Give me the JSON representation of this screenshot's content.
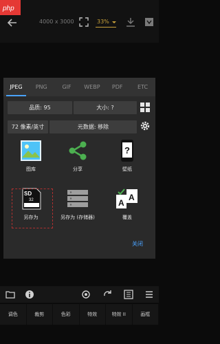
{
  "topbar": {
    "dimensions": "4000 x 3000",
    "zoom": "33%"
  },
  "tabs": [
    {
      "label": "JPEG",
      "active": true
    },
    {
      "label": "PNG",
      "active": false
    },
    {
      "label": "GIF",
      "active": false
    },
    {
      "label": "WEBP",
      "active": false
    },
    {
      "label": "PDF",
      "active": false
    },
    {
      "label": "ETC",
      "active": false
    }
  ],
  "options": {
    "quality": "品质: 95",
    "size": "大小: ?",
    "dpi": "72 像素/英寸",
    "metadata": "元数据: 移除"
  },
  "actions": [
    {
      "label": "图库",
      "icon": "gallery-icon"
    },
    {
      "label": "分享",
      "icon": "share-icon"
    },
    {
      "label": "壁纸",
      "icon": "wallpaper-icon"
    },
    {
      "label": "另存为",
      "icon": "sd-card-icon"
    },
    {
      "label": "另存为 (存储器)",
      "icon": "storage-icon"
    },
    {
      "label": "覆盖",
      "icon": "overwrite-icon"
    }
  ],
  "dialog": {
    "close_label": "关闭"
  },
  "bottom_tabs": [
    "调色",
    "裁剪",
    "色彩",
    "特效",
    "特效 II",
    "画框"
  ],
  "colors": {
    "accent": "#4aa3ff",
    "zoom_accent": "#c9a13a",
    "dialog_bg": "#2a2a2a",
    "button_bg": "#3d3d3d",
    "share_green": "#4caf50"
  }
}
